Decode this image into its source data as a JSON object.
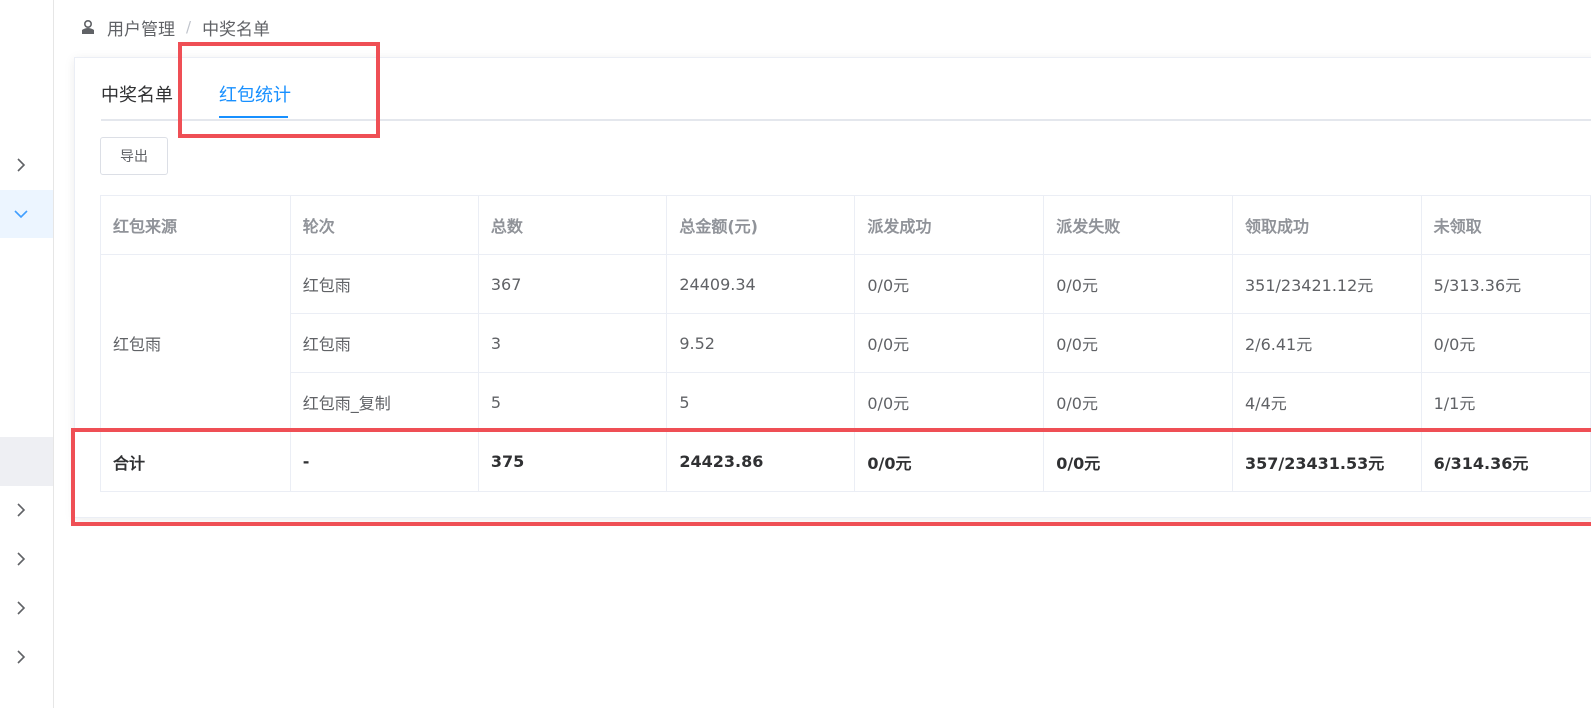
{
  "breadcrumb": {
    "root": "用户管理",
    "separator": "/",
    "current": "中奖名单"
  },
  "tabs": [
    {
      "label": "中奖名单",
      "active": false
    },
    {
      "label": "红包统计",
      "active": true
    }
  ],
  "toolbar": {
    "export_label": "导出"
  },
  "table": {
    "headers": [
      "红包来源",
      "轮次",
      "总数",
      "总金额(元)",
      "派发成功",
      "派发失败",
      "领取成功",
      "未领取"
    ],
    "source": "红包雨",
    "rows": [
      {
        "round": "红包雨",
        "total": "367",
        "amount": "24409.34",
        "sent_ok": "0/0元",
        "sent_fail": "0/0元",
        "claimed": "351/23421.12元",
        "unclaimed": "5/313.36元"
      },
      {
        "round": "红包雨",
        "total": "3",
        "amount": "9.52",
        "sent_ok": "0/0元",
        "sent_fail": "0/0元",
        "claimed": "2/6.41元",
        "unclaimed": "0/0元"
      },
      {
        "round": "红包雨_复制",
        "total": "5",
        "amount": "5",
        "sent_ok": "0/0元",
        "sent_fail": "0/0元",
        "claimed": "4/4元",
        "unclaimed": "1/1元"
      }
    ],
    "total_row": {
      "label": "合计",
      "round": "-",
      "total": "375",
      "amount": "24423.86",
      "sent_ok": "0/0元",
      "sent_fail": "0/0元",
      "claimed": "357/23431.53元",
      "unclaimed": "6/314.36元"
    }
  },
  "colors": {
    "accent": "#1890ff",
    "annotation": "#ef4f55"
  }
}
